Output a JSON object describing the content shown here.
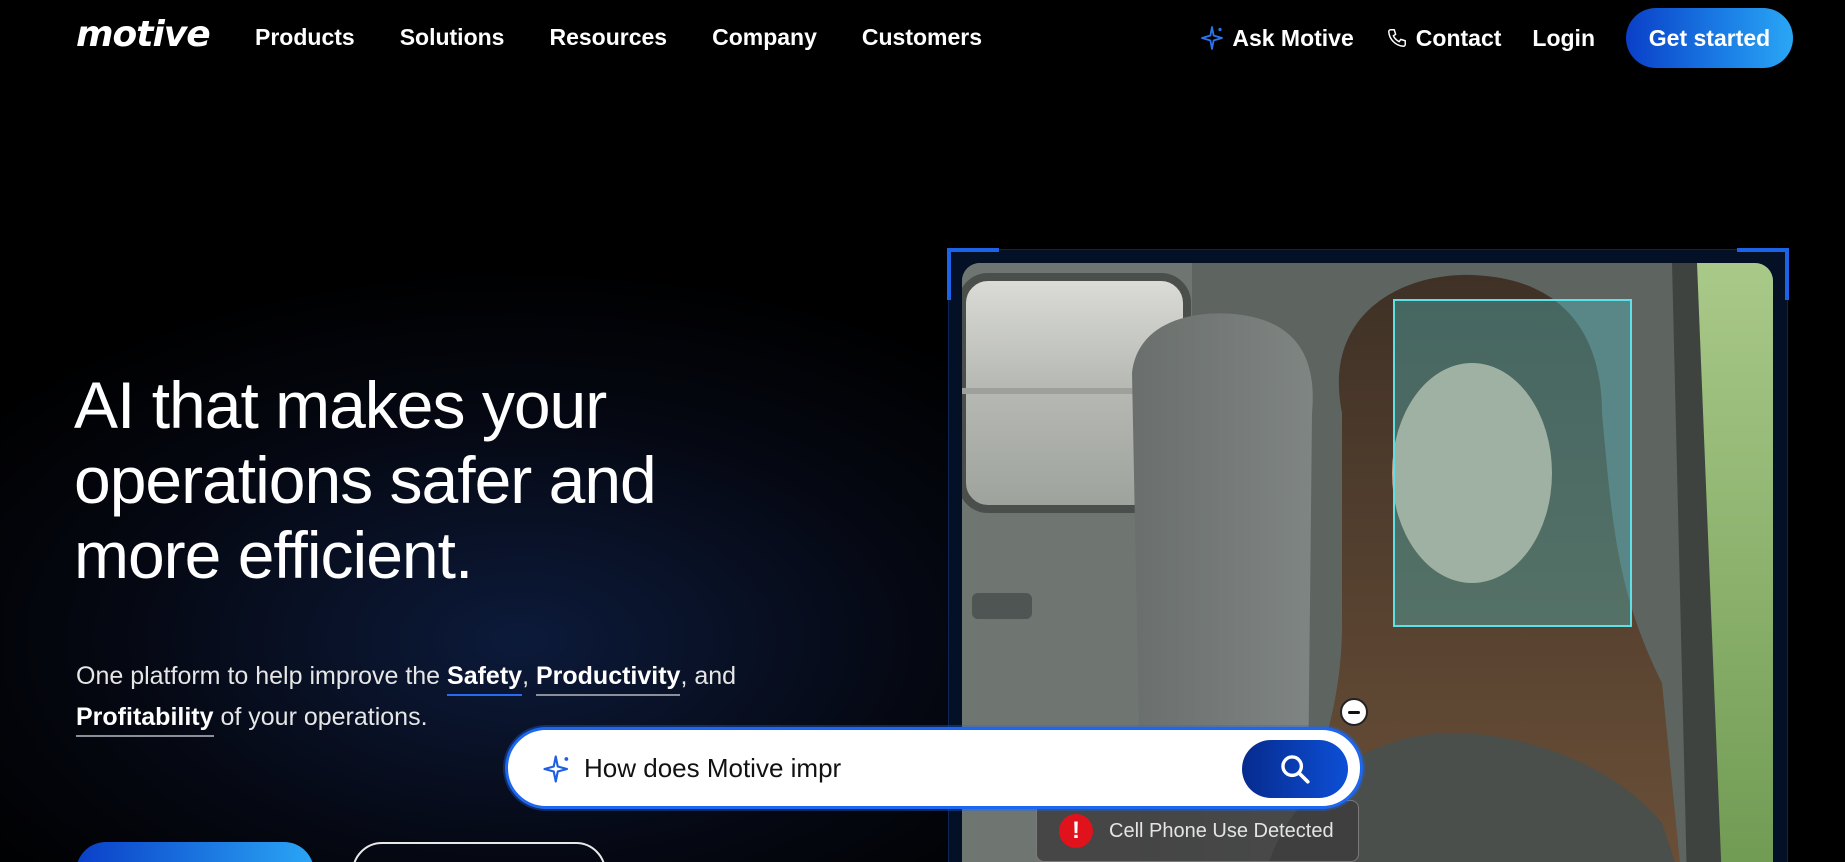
{
  "header": {
    "logo": "motive",
    "nav": [
      "Products",
      "Solutions",
      "Resources",
      "Company",
      "Customers"
    ],
    "ask_label": "Ask Motive",
    "contact_label": "Contact",
    "login_label": "Login",
    "get_started_label": "Get started"
  },
  "hero": {
    "title_line1": "AI that makes your",
    "title_line2": "operations safer and",
    "title_line3": "more efficient.",
    "subtitle_prefix": "One platform to help improve the ",
    "kw_safety": "Safety",
    "sep1": ", ",
    "kw_productivity": "Productivity",
    "sep2": ", and",
    "kw_profitability": "Profitability",
    "subtitle_suffix": " of your operations."
  },
  "media": {
    "alert_icon": "!",
    "alert_text": "Cell Phone Use Detected"
  },
  "ask_widget": {
    "input_value": "How does Motive impr",
    "icons": {
      "spark": "sparkle-icon",
      "submit": "search-icon",
      "minimize": "minus-circle-icon"
    }
  },
  "colors": {
    "accent": "#1D66F0",
    "accent_light": "#2AA6F5",
    "face_box": "#5FE0E6",
    "alert_red": "#E0121B"
  }
}
